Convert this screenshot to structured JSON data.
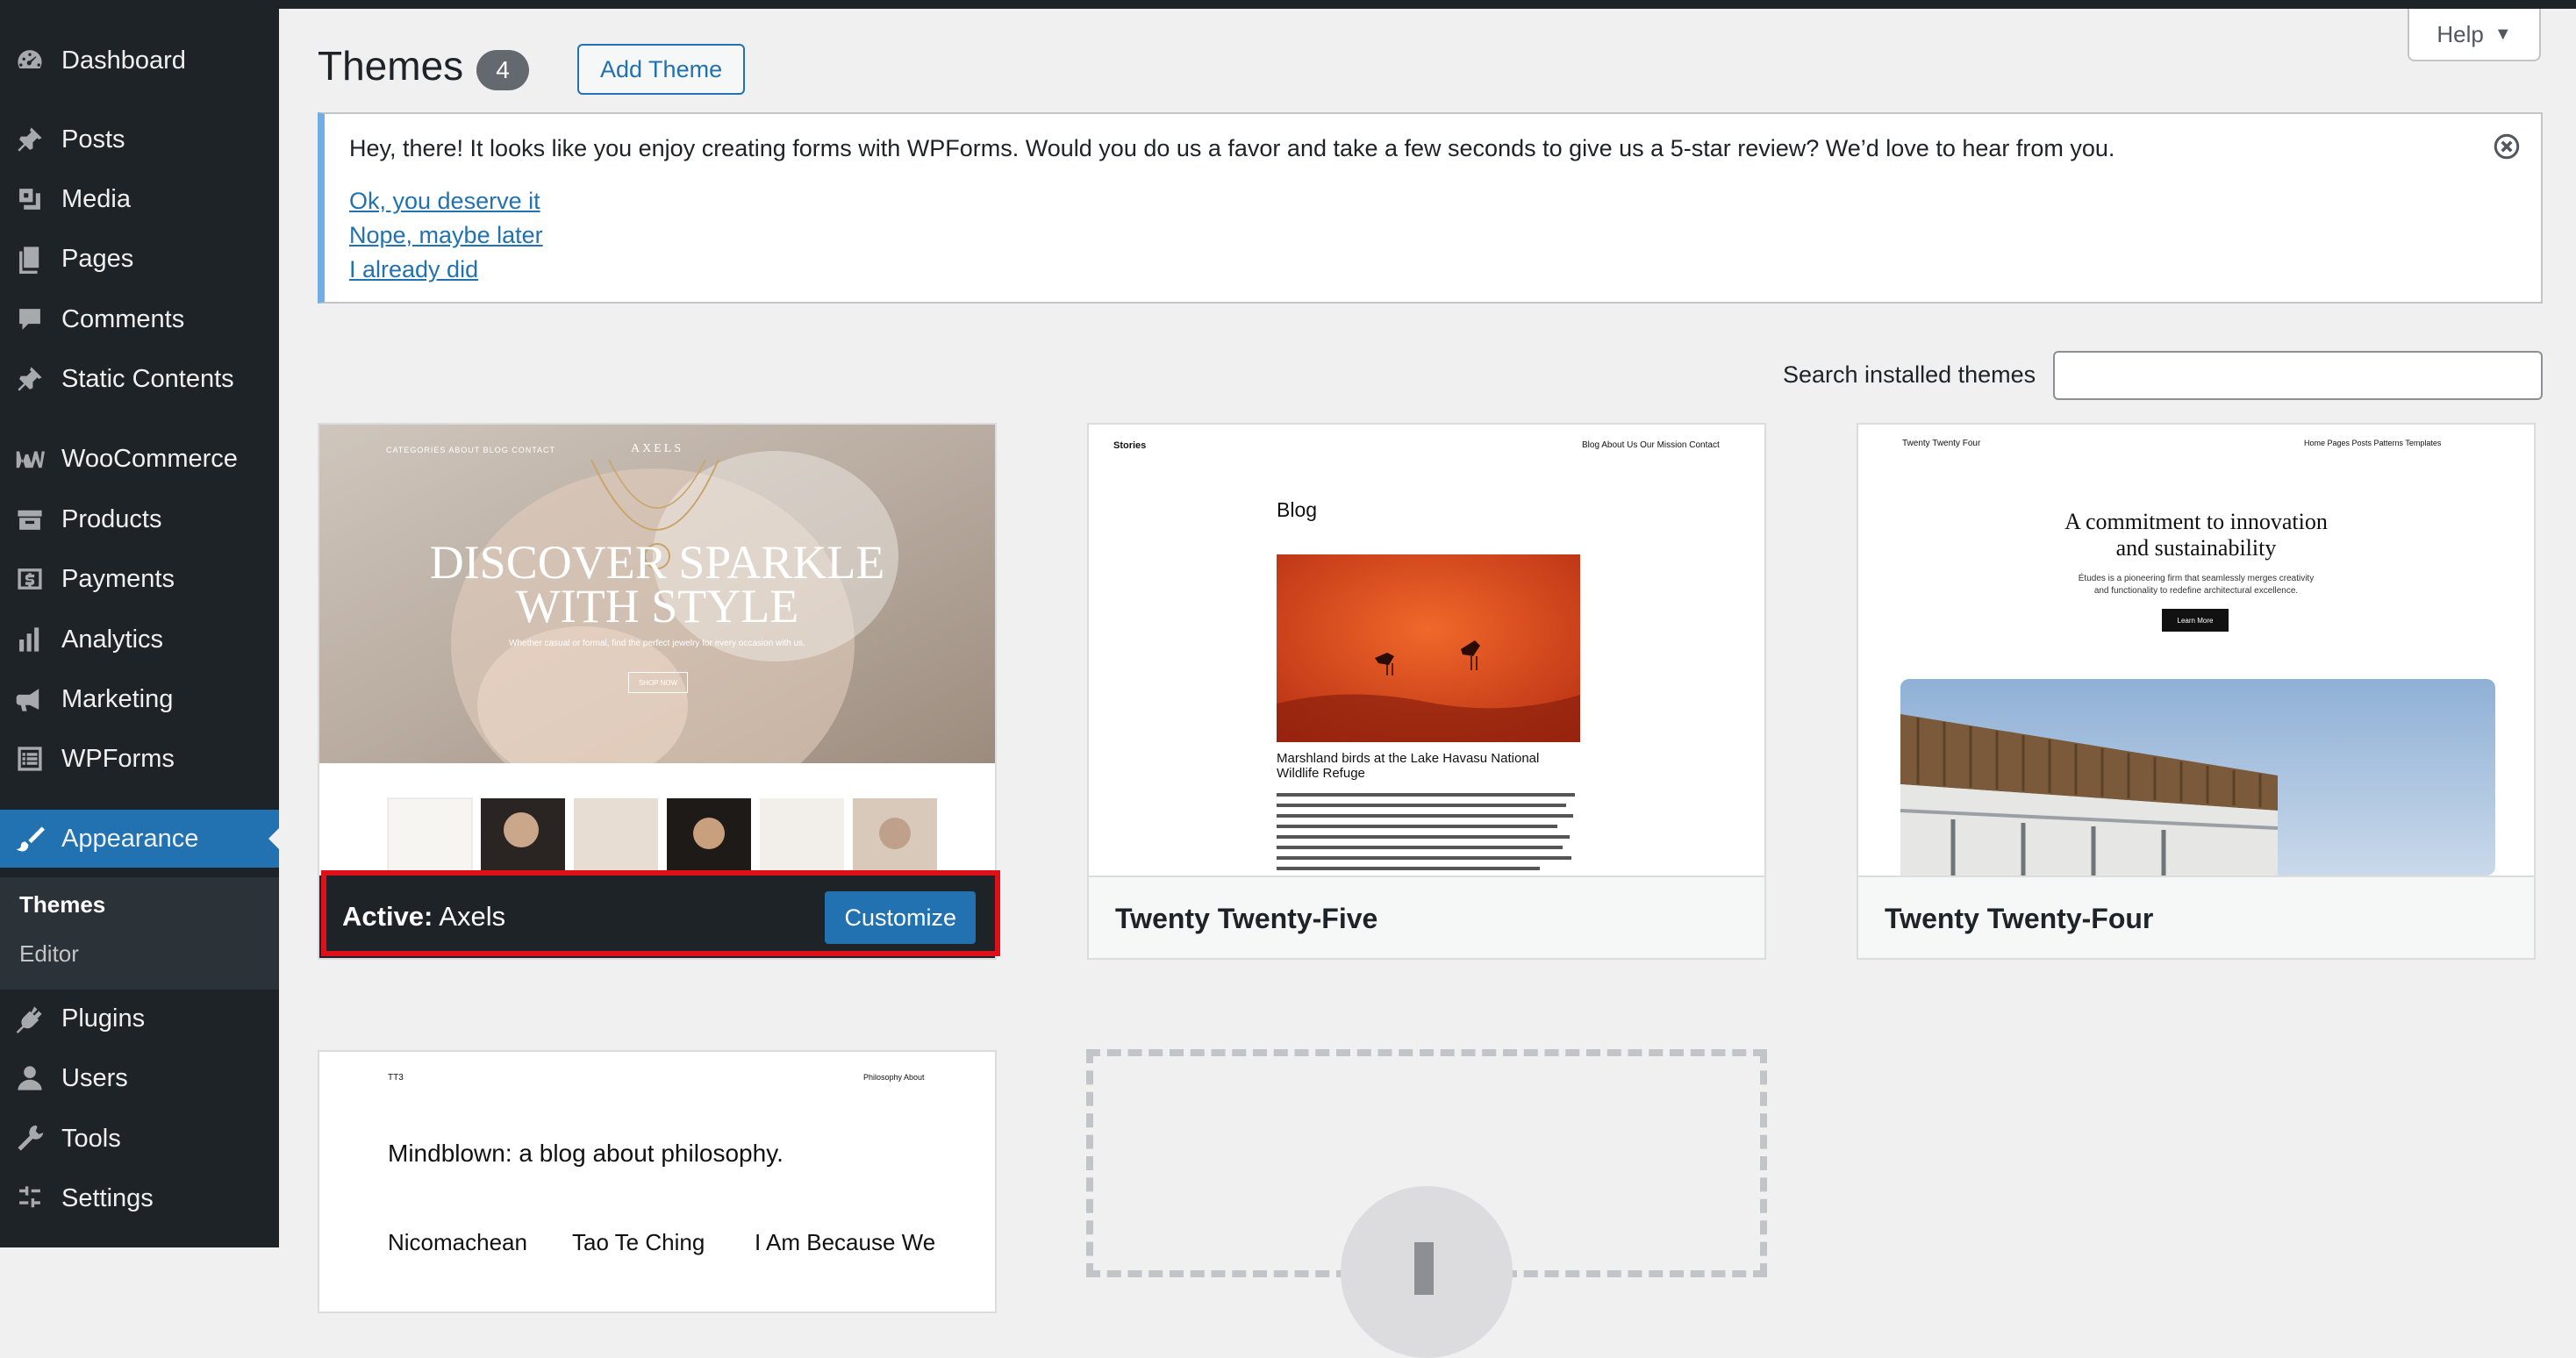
{
  "sidebar": {
    "items": [
      {
        "label": "Dashboard",
        "icon": "dashboard-icon"
      },
      {
        "label": "Posts",
        "icon": "pin-icon"
      },
      {
        "label": "Media",
        "icon": "media-icon"
      },
      {
        "label": "Pages",
        "icon": "pages-icon"
      },
      {
        "label": "Comments",
        "icon": "comment-icon"
      },
      {
        "label": "Static Contents",
        "icon": "pin-icon"
      },
      {
        "label": "WooCommerce",
        "icon": "woo-icon"
      },
      {
        "label": "Products",
        "icon": "archive-icon"
      },
      {
        "label": "Payments",
        "icon": "dollar-icon"
      },
      {
        "label": "Analytics",
        "icon": "bar-chart-icon"
      },
      {
        "label": "Marketing",
        "icon": "megaphone-icon"
      },
      {
        "label": "WPForms",
        "icon": "form-icon"
      },
      {
        "label": "Appearance",
        "icon": "brush-icon"
      },
      {
        "label": "Plugins",
        "icon": "plugin-icon"
      },
      {
        "label": "Users",
        "icon": "user-icon"
      },
      {
        "label": "Tools",
        "icon": "wrench-icon"
      },
      {
        "label": "Settings",
        "icon": "settings-icon"
      }
    ],
    "submenu": {
      "themes": "Themes",
      "editor": "Editor"
    }
  },
  "header": {
    "title": "Themes",
    "count": "4",
    "add_theme": "Add Theme",
    "help": "Help"
  },
  "notice": {
    "text": "Hey, there! It looks like you enjoy creating forms with WPForms. Would you do us a favor and take a few seconds to give us a 5-star review? We’d love to hear from you.",
    "links": [
      "Ok, you deserve it",
      "Nope, maybe later",
      "I already did"
    ]
  },
  "search": {
    "label": "Search installed themes",
    "value": ""
  },
  "themes": {
    "axels": {
      "active_prefix": "Active:",
      "name": "Axels",
      "customize": "Customize",
      "preview": {
        "nav": "CATEGORIES   ABOUT   BLOG   CONTACT",
        "logo": "AXELS",
        "headline1": "DISCOVER SPARKLE",
        "headline2": "WITH STYLE",
        "sub": "Whether casual or formal, find the perfect jewelry for every occasion with us.",
        "cta": "SHOP NOW"
      }
    },
    "tt5": {
      "name": "Twenty Twenty-Five",
      "preview": {
        "site": "Stories",
        "nav": "Blog   About Us   Our Mission   Contact",
        "heading": "Blog",
        "caption": "Marshland birds at the Lake Havasu National Wildlife Refuge"
      }
    },
    "tt4": {
      "name": "Twenty Twenty-Four",
      "preview": {
        "site": "Twenty Twenty Four",
        "nav": "Home   Pages   Posts   Patterns   Templates",
        "headline1": "A commitment to innovation",
        "headline2": "and sustainability",
        "sub1": "Études is a pioneering firm that seamlessly merges creativity",
        "sub2": "and functionality to redefine architectural excellence.",
        "cta": "Learn More"
      }
    },
    "tt3": {
      "preview": {
        "site": "TT3",
        "nav": "Philosophy   About",
        "heading": "Mindblown: a blog about philosophy.",
        "col1": "Nicomachean",
        "col2": "Tao Te Ching",
        "col3": "I Am Because We"
      }
    }
  }
}
